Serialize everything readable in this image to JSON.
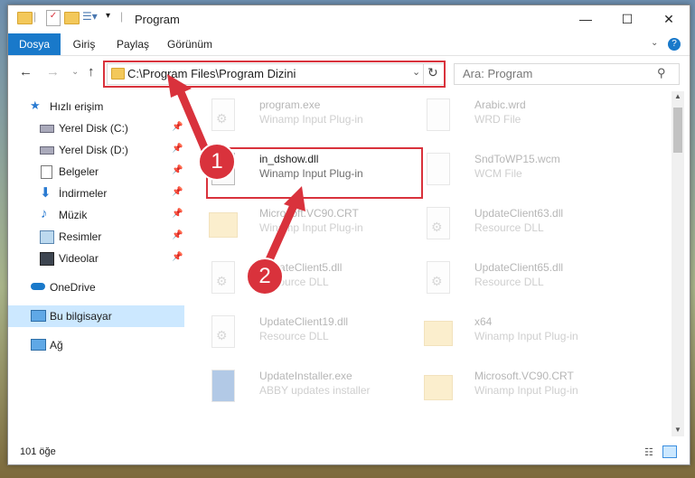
{
  "window": {
    "title": "Program",
    "minimize": "—",
    "maximize": "☐",
    "close": "✕"
  },
  "ribbon": {
    "tabs": [
      "Dosya",
      "Giriş",
      "Paylaş",
      "Görünüm"
    ],
    "help": "?"
  },
  "nav": {
    "address": "C:\\Program Files\\Program Dizini",
    "search_placeholder": "Ara: Program"
  },
  "sidebar": {
    "items": [
      {
        "label": "Hızlı erişim",
        "icon": "star-icon"
      },
      {
        "label": "Yerel Disk (C:)",
        "icon": "drive-icon"
      },
      {
        "label": "Yerel Disk (D:)",
        "icon": "drive-icon"
      },
      {
        "label": "Belgeler",
        "icon": "documents-icon"
      },
      {
        "label": "İndirmeler",
        "icon": "download-icon"
      },
      {
        "label": "Müzik",
        "icon": "music-icon"
      },
      {
        "label": "Resimler",
        "icon": "pictures-icon"
      },
      {
        "label": "Videolar",
        "icon": "videos-icon"
      },
      {
        "label": "OneDrive",
        "icon": "cloud-icon"
      },
      {
        "label": "Bu bilgisayar",
        "icon": "computer-icon"
      },
      {
        "label": "Ağ",
        "icon": "network-icon"
      }
    ]
  },
  "files": [
    {
      "name": "program.exe",
      "desc": "Winamp Input Plug-in"
    },
    {
      "name": "Arabic.wrd",
      "desc": "WRD File"
    },
    {
      "name": "in_dshow.dll",
      "desc": "Winamp Input Plug-in"
    },
    {
      "name": "SndToWP15.wcm",
      "desc": "WCM File"
    },
    {
      "name": "Microsoft.VC90.CRT",
      "desc": "Winamp Input Plug-in"
    },
    {
      "name": "UpdateClient63.dll",
      "desc": "Resource DLL"
    },
    {
      "name": "UpdateClient5.dll",
      "desc": "Resource DLL"
    },
    {
      "name": "UpdateClient65.dll",
      "desc": "Resource DLL"
    },
    {
      "name": "UpdateClient19.dll",
      "desc": "Resource DLL"
    },
    {
      "name": "x64",
      "desc": "Winamp Input Plug-in"
    },
    {
      "name": "UpdateInstaller.exe",
      "desc": "ABBY updates installer"
    },
    {
      "name": "Microsoft.VC90.CRT",
      "desc": "Winamp Input Plug-in"
    }
  ],
  "status": {
    "count": "101 öğe"
  },
  "callouts": [
    "1",
    "2"
  ],
  "colors": {
    "accent": "#1979ca",
    "highlight": "#d9323c"
  }
}
